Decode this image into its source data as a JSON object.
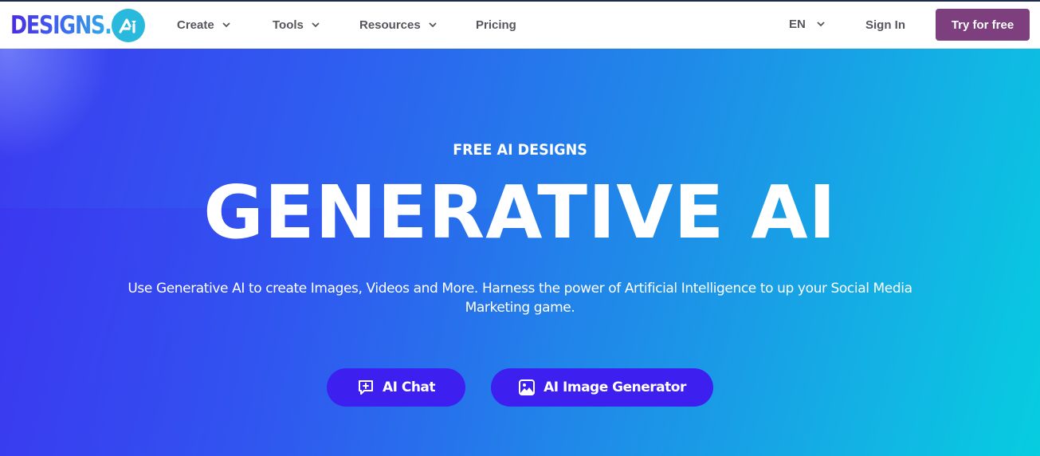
{
  "brand": {
    "logo_text": "DESIGNS.",
    "logo_badge": "AI",
    "colors": {
      "logo_gradient_start": "#4a2be0",
      "logo_gradient_end": "#2fb0e8",
      "badge": "#28b9dc",
      "cta_primary": "#7d3f7e",
      "hero_button": "#3d1ff0"
    }
  },
  "nav": {
    "items": [
      {
        "label": "Create",
        "icon": "chevron-down-icon",
        "has_dropdown": true
      },
      {
        "label": "Tools",
        "icon": "chevron-down-icon",
        "has_dropdown": true
      },
      {
        "label": "Resources",
        "icon": "chevron-down-icon",
        "has_dropdown": true
      },
      {
        "label": "Pricing",
        "has_dropdown": false
      }
    ],
    "language": {
      "label": "EN",
      "icon": "chevron-down-icon"
    },
    "sign_in": "Sign In",
    "try_free": "Try for free"
  },
  "hero": {
    "eyebrow": "FREE AI DESIGNS",
    "title": "GENERATIVE AI",
    "description": "Use Generative AI to create Images, Videos and More. Harness the power of Artificial Intelligence to up your Social Media Marketing game.",
    "buttons": [
      {
        "label": "AI Chat",
        "icon": "chat-plus-icon"
      },
      {
        "label": "AI Image Generator",
        "icon": "image-icon"
      }
    ]
  }
}
